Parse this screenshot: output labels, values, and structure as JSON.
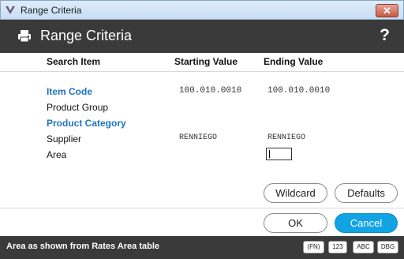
{
  "window": {
    "title": "Range Criteria",
    "close_label": "✕"
  },
  "header": {
    "title": "Range Criteria",
    "help_label": "?"
  },
  "columns": {
    "search_item": "Search Item",
    "starting_value": "Starting Value",
    "ending_value": "Ending Value"
  },
  "rows": [
    {
      "label": "Item Code",
      "start": "100.010.0010",
      "end": "100.010.0010"
    },
    {
      "label": "Product Group",
      "start": "",
      "end": ""
    },
    {
      "label": "Product Category",
      "start": "",
      "end": ""
    },
    {
      "label": "Supplier",
      "start": "RENNIEGO",
      "end": "RENNIEGO"
    },
    {
      "label": "Area",
      "start": "",
      "end": ""
    }
  ],
  "buttons": {
    "wildcard": "Wildcard",
    "defaults": "Defaults",
    "ok": "OK",
    "cancel": "Cancel"
  },
  "status": {
    "text": "Area as shown from Rates Area table",
    "badges": [
      "(FN)",
      "123",
      "ABC",
      "DBG"
    ]
  },
  "colors": {
    "header_bg": "#3a3a3a",
    "link": "#1e73be",
    "primary": "#12a3e5"
  },
  "icons": {
    "app": "app-logo-icon",
    "print": "printer-icon"
  }
}
